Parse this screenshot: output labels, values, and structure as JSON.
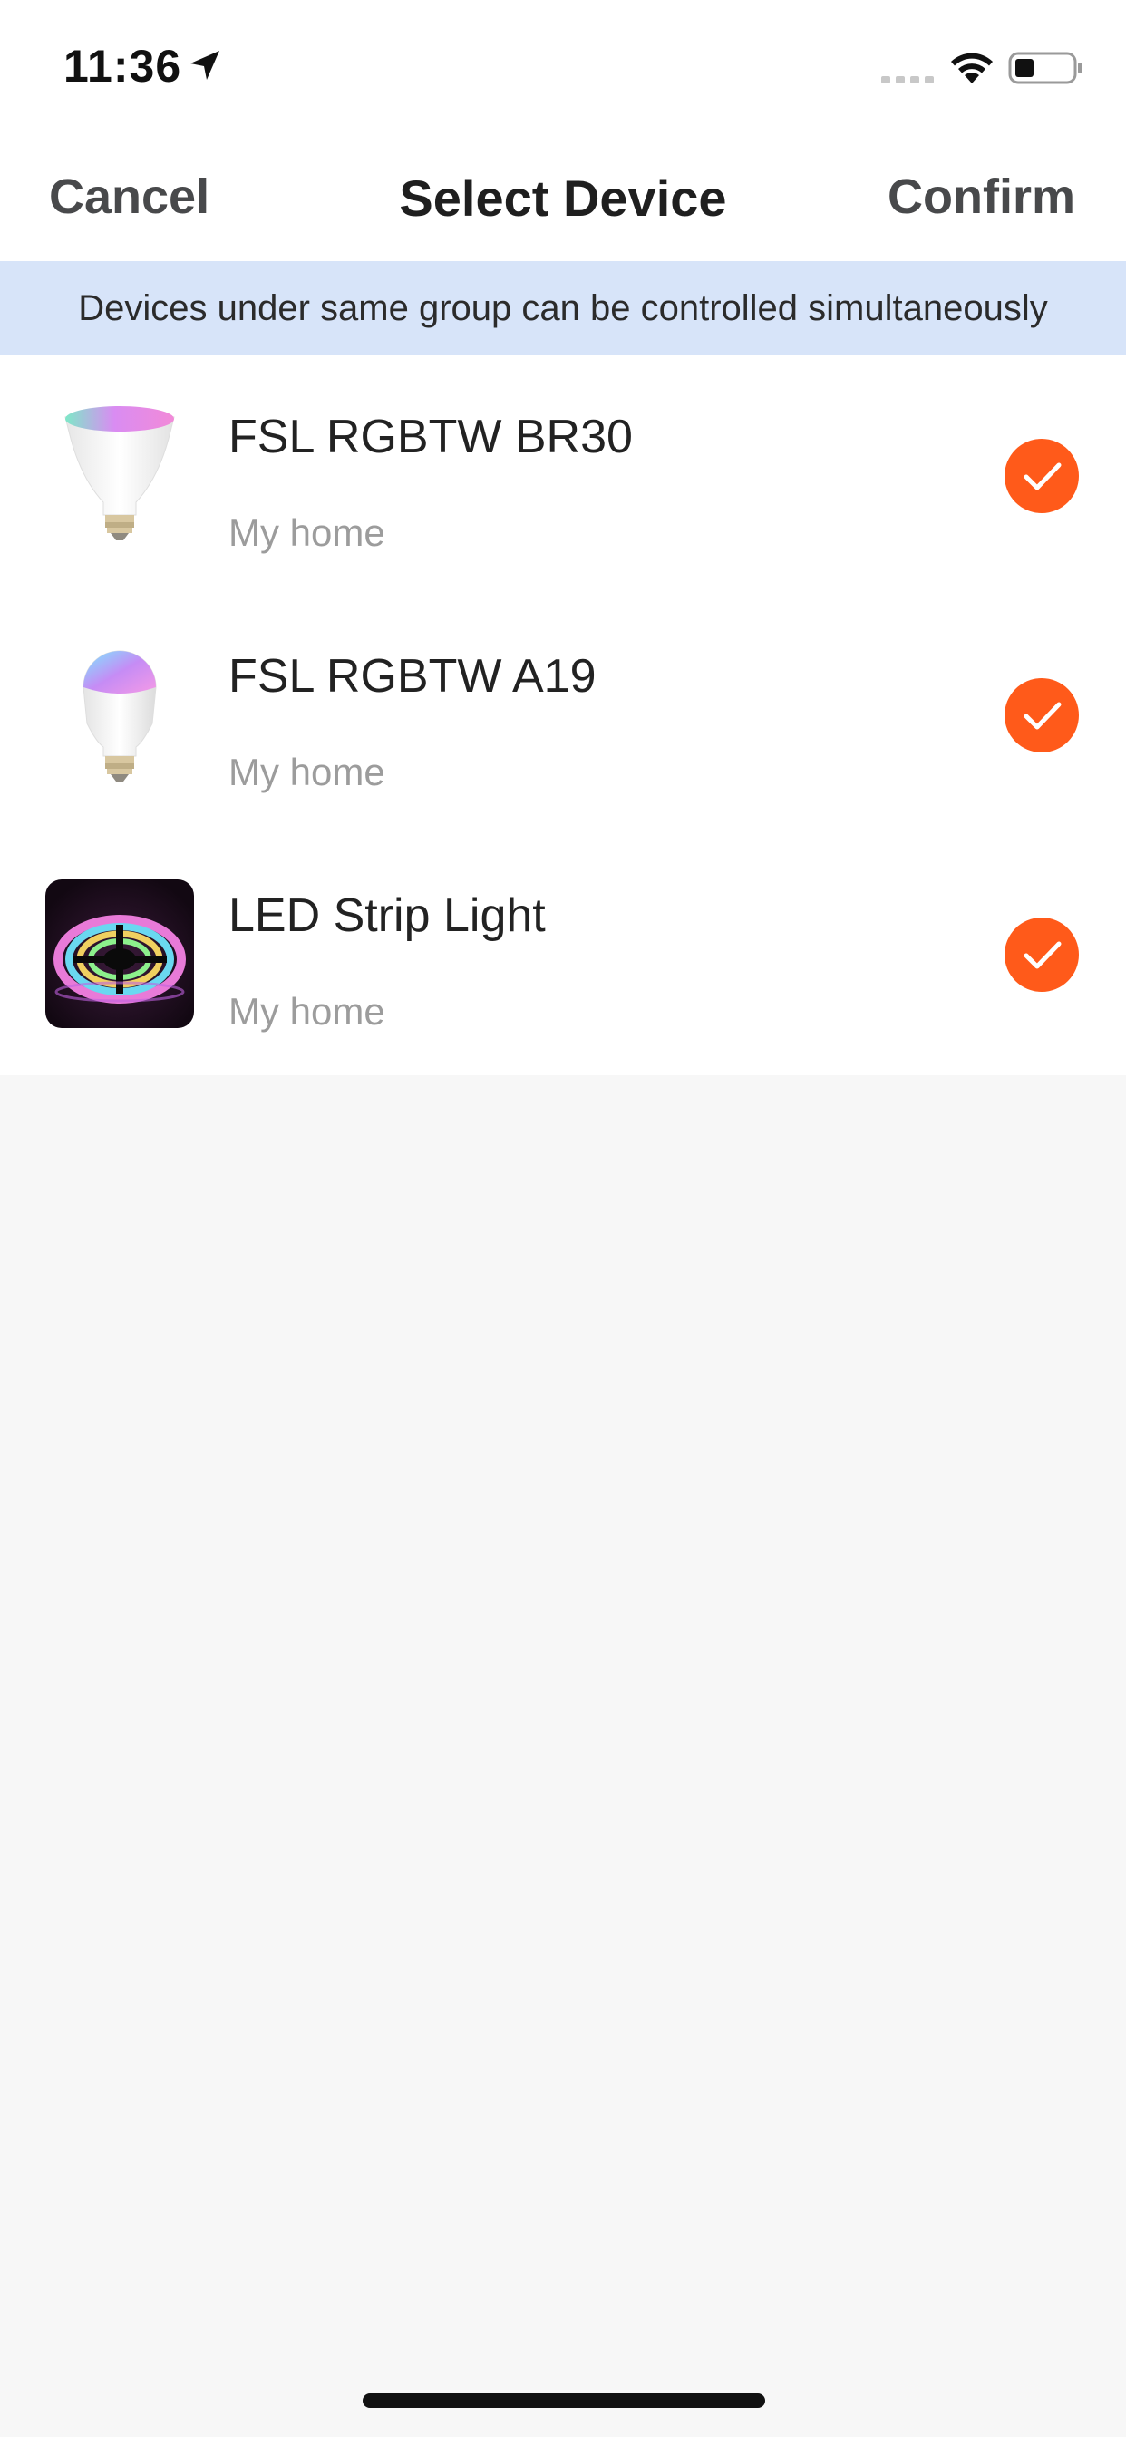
{
  "status_bar": {
    "time": "11:36",
    "location_icon": "location-arrow-icon",
    "signal_icon": "cellular-signal-icon",
    "wifi_icon": "wifi-icon",
    "battery_icon": "battery-icon"
  },
  "nav": {
    "cancel_label": "Cancel",
    "title": "Select Device",
    "confirm_label": "Confirm"
  },
  "banner": {
    "text": "Devices under same group can be controlled simultaneously"
  },
  "devices": [
    {
      "name": "FSL RGBTW BR30",
      "subtitle": "My home",
      "selected": true,
      "thumbnail": "br30-bulb-icon"
    },
    {
      "name": "FSL RGBTW A19",
      "subtitle": "My home",
      "selected": true,
      "thumbnail": "a19-bulb-icon"
    },
    {
      "name": "LED Strip Light",
      "subtitle": "My home",
      "selected": true,
      "thumbnail": "led-strip-icon"
    }
  ],
  "colors": {
    "accent": "#ff5a1a",
    "banner_bg": "#d7e4f9",
    "page_bg": "#f7f7f7"
  }
}
